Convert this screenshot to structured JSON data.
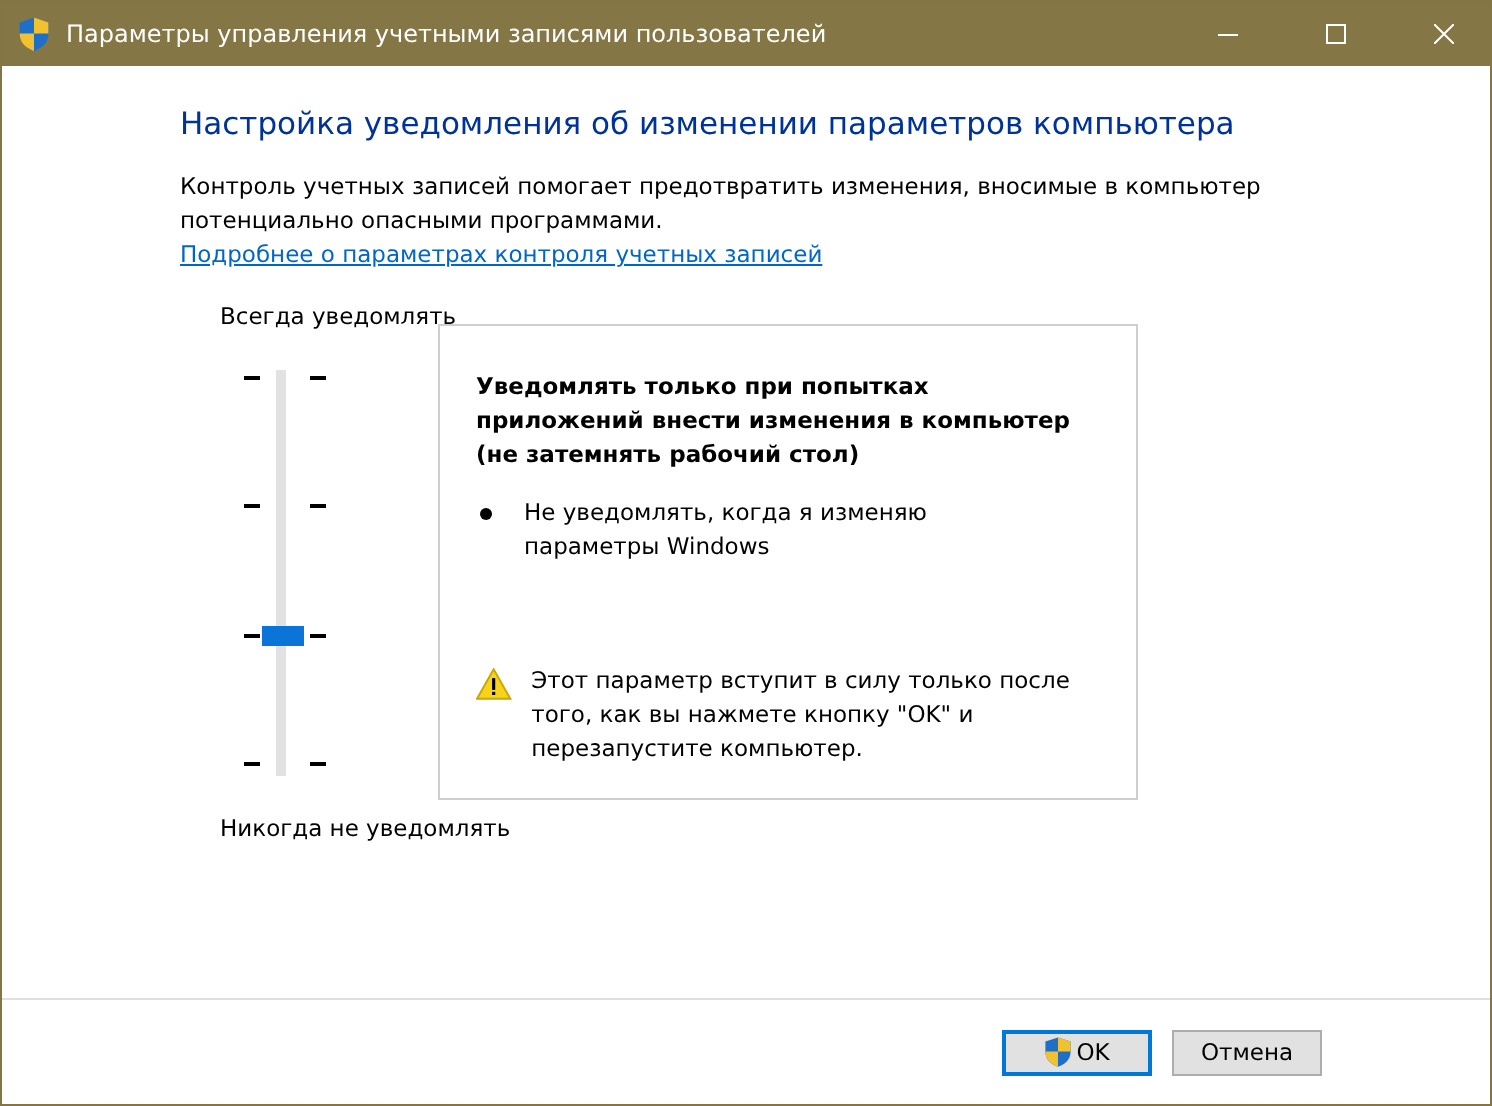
{
  "window": {
    "title": "Параметры управления учетными записями пользователей"
  },
  "heading": "Настройка уведомления об изменении параметров компьютера",
  "description": "Контроль учетных записей помогает предотвратить изменения, вносимые в компьютер потенциально опасными программами.",
  "link": "Подробнее о параметрах контроля учетных записей",
  "slider": {
    "top_label": "Всегда уведомлять",
    "bottom_label": "Никогда не уведомлять",
    "level": 0.3333
  },
  "info": {
    "title": "Уведомлять только при попытках приложений внести изменения в компьютер (не затемнять рабочий стол)",
    "bullets": [
      "Не уведомлять, когда я изменяю параметры Windows"
    ],
    "warning": "Этот параметр вступит в силу только после того, как вы нажмете кнопку \"OK\" и перезапустите компьютер."
  },
  "buttons": [
    {
      "label": "OK",
      "kind": "shield-default"
    },
    {
      "label": "Отмена",
      "kind": "plain"
    }
  ]
}
